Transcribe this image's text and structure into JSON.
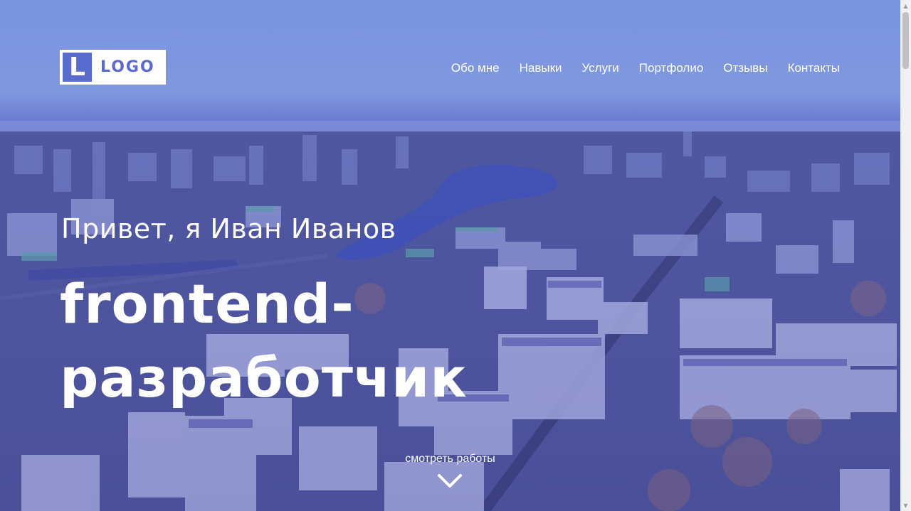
{
  "header": {
    "logo": {
      "mark": "L",
      "text": "LOGO"
    },
    "nav": [
      {
        "label": "Обо мне"
      },
      {
        "label": "Навыки"
      },
      {
        "label": "Услуги"
      },
      {
        "label": "Портфолио"
      },
      {
        "label": "Отзывы"
      },
      {
        "label": "Контакты"
      }
    ]
  },
  "hero": {
    "greeting": "Привет, я Иван Иванов",
    "title_line1": "frontend-",
    "title_line2": "разработчик",
    "cta": "смотреть работы",
    "background": "aerial-city-photo",
    "overlay_color": "#5a6bd0"
  },
  "icons": {
    "cta_arrow": "chevron-down-icon"
  },
  "colors": {
    "accent": "#5a6bd0",
    "text": "#ffffff"
  }
}
